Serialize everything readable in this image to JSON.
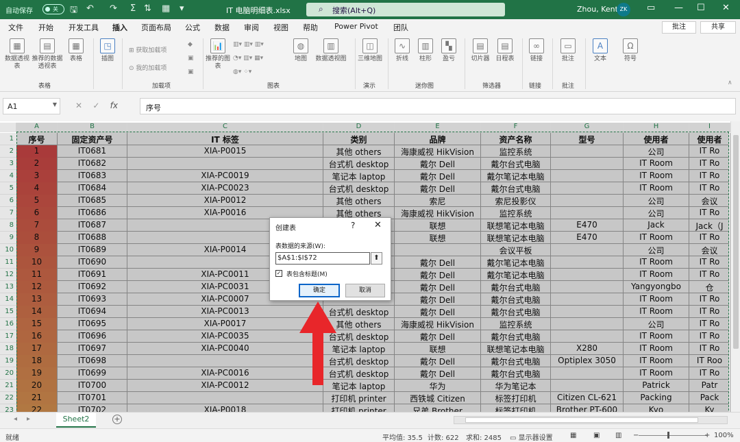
{
  "titlebar": {
    "autosave_label": "自动保存",
    "autosave_state": "关",
    "filename": "IT 电脑明细表.xlsx",
    "search_placeholder": "搜索(Alt+Q)",
    "user_name": "Zhou, Kent",
    "avatar_initials": "ZK"
  },
  "tabs": [
    "文件",
    "开始",
    "开发工具",
    "插入",
    "页面布局",
    "公式",
    "数据",
    "审阅",
    "视图",
    "帮助",
    "Power Pivot",
    "团队"
  ],
  "active_tab": "插入",
  "comment_button": "批注",
  "share_button": "共享",
  "ribbon": {
    "pivot_table": "数据透视表",
    "recommended_pivot": "推荐的数据透视表",
    "table": "表格",
    "illustrations": "插图",
    "get_addins": "获取加载项",
    "my_addins": "我的加载项",
    "recommended_charts": "推荐的图表",
    "maps": "地图",
    "pivot_chart": "数据透视图",
    "3d_map": "三维地图",
    "line": "折线",
    "column": "柱形",
    "win_loss": "盈亏",
    "slicer": "切片器",
    "timeline": "日程表",
    "link": "链接",
    "comment": "批注",
    "text": "文本",
    "symbol": "符号",
    "groups": {
      "tables": "表格",
      "addins": "加载项",
      "charts": "图表",
      "tours": "演示",
      "sparklines": "迷你图",
      "filters": "筛选器",
      "links": "链接",
      "comments": "批注"
    }
  },
  "formula_bar": {
    "name_box": "A1",
    "formula": "序号"
  },
  "columns": [
    "A",
    "B",
    "C",
    "D",
    "E",
    "F",
    "G",
    "H",
    "I"
  ],
  "header_row": [
    "序号",
    "固定资产号",
    "IT 标签",
    "类别",
    "品牌",
    "资产名称",
    "型号",
    "使用者",
    "使用者"
  ],
  "rows": [
    [
      "1",
      "IT0681",
      "XIA-P0015",
      "其他 others",
      "海康威视 HikVision",
      "监控系统",
      "",
      "公司",
      "IT Ro"
    ],
    [
      "2",
      "IT0682",
      "",
      "台式机 desktop",
      "戴尔 Dell",
      "戴尔台式电脑",
      "",
      "IT Room",
      "IT Ro"
    ],
    [
      "3",
      "IT0683",
      "XIA-PC0019",
      "笔记本 laptop",
      "戴尔 Dell",
      "戴尔笔记本电脑",
      "",
      "IT Room",
      "IT Ro"
    ],
    [
      "4",
      "IT0684",
      "XIA-PC0023",
      "台式机 desktop",
      "戴尔 Dell",
      "戴尔台式电脑",
      "",
      "IT Room",
      "IT Ro"
    ],
    [
      "5",
      "IT0685",
      "XIA-P0012",
      "其他 others",
      "索尼",
      "索尼投影仪",
      "",
      "公司",
      "会议"
    ],
    [
      "6",
      "IT0686",
      "XIA-P0016",
      "其他 others",
      "海康威视 HikVision",
      "监控系统",
      "",
      "公司",
      "IT Ro"
    ],
    [
      "7",
      "IT0687",
      "",
      "",
      "联想",
      "联想笔记本电脑",
      "E470",
      "Jack",
      "Jack（J"
    ],
    [
      "8",
      "IT0688",
      "",
      "",
      "联想",
      "联想笔记本电脑",
      "E470",
      "IT Room",
      "IT Ro"
    ],
    [
      "9",
      "IT0689",
      "XIA-P0014",
      "",
      "",
      "会议平板",
      "",
      "公司",
      "会议"
    ],
    [
      "10",
      "IT0690",
      "",
      "",
      "戴尔 Dell",
      "戴尔笔记本电脑",
      "",
      "IT Room",
      "IT Ro"
    ],
    [
      "11",
      "IT0691",
      "XIA-PC0011",
      "",
      "戴尔 Dell",
      "戴尔笔记本电脑",
      "",
      "IT Room",
      "IT Ro"
    ],
    [
      "12",
      "IT0692",
      "XIA-PC0031",
      "",
      "戴尔 Dell",
      "戴尔台式电脑",
      "",
      "Yangyongbo",
      "仓"
    ],
    [
      "13",
      "IT0693",
      "XIA-PC0007",
      "",
      "戴尔 Dell",
      "戴尔台式电脑",
      "",
      "IT Room",
      "IT Ro"
    ],
    [
      "14",
      "IT0694",
      "XIA-PC0013",
      "台式机 desktop",
      "戴尔 Dell",
      "戴尔台式电脑",
      "",
      "IT Room",
      "IT Ro"
    ],
    [
      "15",
      "IT0695",
      "XIA-P0017",
      "其他 others",
      "海康威视 HikVision",
      "监控系统",
      "",
      "公司",
      "IT Ro"
    ],
    [
      "16",
      "IT0696",
      "XIA-PC0035",
      "台式机 desktop",
      "戴尔 Dell",
      "戴尔台式电脑",
      "",
      "IT Room",
      "IT Ro"
    ],
    [
      "17",
      "IT0697",
      "XIA-PC0040",
      "笔记本 laptop",
      "联想",
      "联想笔记本电脑",
      "X280",
      "IT Room",
      "IT Ro"
    ],
    [
      "18",
      "IT0698",
      "",
      "台式机 desktop",
      "戴尔 Dell",
      "戴尔台式电脑",
      "Optiplex 3050",
      "IT Room",
      "IT Roo"
    ],
    [
      "19",
      "IT0699",
      "XIA-PC0016",
      "台式机 desktop",
      "戴尔 Dell",
      "戴尔台式电脑",
      "",
      "IT Room",
      "IT Ro"
    ],
    [
      "20",
      "IT0700",
      "XIA-PC0012",
      "笔记本 laptop",
      "华为",
      "华为笔记本",
      "",
      "Patrick",
      "Patr"
    ],
    [
      "21",
      "IT0701",
      "",
      "打印机 printer",
      "西铁城 Citizen",
      "标签打印机",
      "Citizen CL-621",
      "Packing",
      "Pack"
    ],
    [
      "22",
      "IT0702",
      "XIA-P0018",
      "打印机 printer",
      "兄弟 Brother",
      "标签打印机",
      "Brother PT-600",
      "Kyo",
      "Ky"
    ]
  ],
  "dialog": {
    "title": "创建表",
    "help": "?",
    "close": "✕",
    "source_label": "表数据的来源(W):",
    "source_value": "$A$1:$I$72",
    "header_checkbox_label": "表包含标题(M)",
    "header_checked": true,
    "ok": "确定",
    "cancel": "取消"
  },
  "sheet_tab": "Sheet2",
  "status": {
    "mode": "就绪",
    "average": "平均值: 35.5",
    "count": "计数: 622",
    "sum": "求和: 2485",
    "display_settings": "显示器设置",
    "zoom": "100%"
  },
  "colors": {
    "excel_green": "#217346",
    "arrow_red": "#e8262a",
    "gradient_top": "#d94b4b",
    "gradient_bottom": "#e39a55"
  }
}
